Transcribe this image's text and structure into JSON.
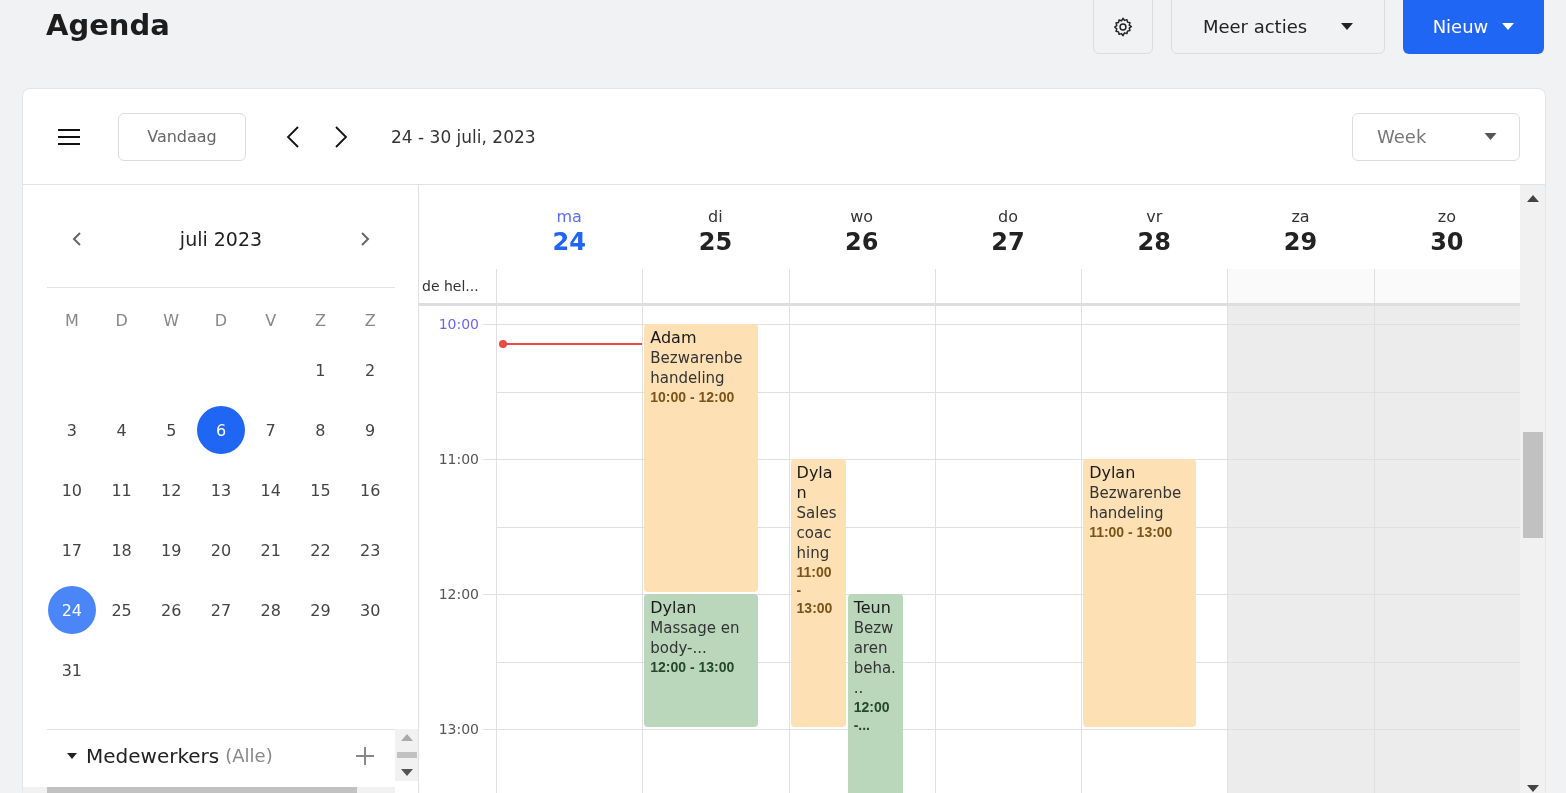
{
  "page": {
    "title": "Agenda"
  },
  "actions": {
    "more": "Meer acties",
    "new": "Nieuw"
  },
  "toolbar": {
    "today": "Vandaag",
    "range": "24 - 30 juli, 2023",
    "view": "Week"
  },
  "mini_calendar": {
    "title": "juli 2023",
    "weekdays": [
      "M",
      "D",
      "W",
      "D",
      "V",
      "Z",
      "Z"
    ],
    "weeks": [
      [
        {
          "day": "1",
          "selected": false,
          "marked": false
        },
        {
          "day": "2",
          "selected": false,
          "marked": false
        }
      ],
      [
        {
          "day": "3",
          "selected": false,
          "marked": false
        },
        {
          "day": "4",
          "selected": false,
          "marked": false
        },
        {
          "day": "5",
          "selected": false,
          "marked": false
        },
        {
          "day": "6",
          "selected": false,
          "marked": true
        },
        {
          "day": "7",
          "selected": false,
          "marked": false
        },
        {
          "day": "8",
          "selected": false,
          "marked": false
        },
        {
          "day": "9",
          "selected": false,
          "marked": false
        }
      ],
      [
        {
          "day": "10",
          "selected": false,
          "marked": false
        },
        {
          "day": "11",
          "selected": false,
          "marked": false
        },
        {
          "day": "12",
          "selected": false,
          "marked": false
        },
        {
          "day": "13",
          "selected": false,
          "marked": false
        },
        {
          "day": "14",
          "selected": false,
          "marked": false
        },
        {
          "day": "15",
          "selected": false,
          "marked": false
        },
        {
          "day": "16",
          "selected": false,
          "marked": false
        }
      ],
      [
        {
          "day": "17",
          "selected": false,
          "marked": false
        },
        {
          "day": "18",
          "selected": false,
          "marked": false
        },
        {
          "day": "19",
          "selected": false,
          "marked": false
        },
        {
          "day": "20",
          "selected": false,
          "marked": false
        },
        {
          "day": "21",
          "selected": false,
          "marked": false
        },
        {
          "day": "22",
          "selected": false,
          "marked": false
        },
        {
          "day": "23",
          "selected": false,
          "marked": false
        }
      ],
      [
        {
          "day": "24",
          "selected": true,
          "marked": false
        },
        {
          "day": "25",
          "selected": false,
          "marked": false
        },
        {
          "day": "26",
          "selected": false,
          "marked": false
        },
        {
          "day": "27",
          "selected": false,
          "marked": false
        },
        {
          "day": "28",
          "selected": false,
          "marked": false
        },
        {
          "day": "29",
          "selected": false,
          "marked": false
        },
        {
          "day": "30",
          "selected": false,
          "marked": false
        }
      ],
      [
        {
          "day": "31",
          "selected": false,
          "marked": false
        }
      ]
    ]
  },
  "staff": {
    "label": "Medewerkers",
    "filter": "(Alle)",
    "expanded": true
  },
  "week": {
    "all_day_label": "de hel...",
    "hours": [
      {
        "label": "10:00",
        "current": true
      },
      {
        "label": "11:00",
        "current": false
      },
      {
        "label": "12:00",
        "current": false
      },
      {
        "label": "13:00",
        "current": false
      }
    ],
    "days": [
      {
        "name": "ma",
        "number": "24",
        "today": true,
        "shaded": false
      },
      {
        "name": "di",
        "number": "25",
        "today": false,
        "shaded": false,
        "events": [
          {
            "person": "Adam",
            "service": "Bezwarenbehandeling",
            "time": "10:00 - 12:00",
            "color": "#fde1b5"
          },
          {
            "person": "Dylan",
            "service": "Massage en body-...",
            "time": "12:00 - 13:00",
            "color": "#bad7bb"
          }
        ]
      },
      {
        "name": "wo",
        "number": "26",
        "today": false,
        "shaded": false,
        "events": [
          {
            "person": "Dylan",
            "service": "Sales coaching",
            "time": "11:00 - 13:00",
            "color": "#fde1b5"
          },
          {
            "person": "Teun",
            "service": "Bezwarenbeha...",
            "time": "12:00 -...",
            "color": "#bad7bb"
          }
        ]
      },
      {
        "name": "do",
        "number": "27",
        "today": false,
        "shaded": false
      },
      {
        "name": "vr",
        "number": "28",
        "today": false,
        "shaded": false,
        "events": [
          {
            "person": "Dylan",
            "service": "Bezwarenbehandeling",
            "time": "11:00 - 13:00",
            "color": "#fde1b5"
          }
        ]
      },
      {
        "name": "za",
        "number": "29",
        "today": false,
        "shaded": true
      },
      {
        "name": "zo",
        "number": "30",
        "today": false,
        "shaded": true
      }
    ]
  }
}
